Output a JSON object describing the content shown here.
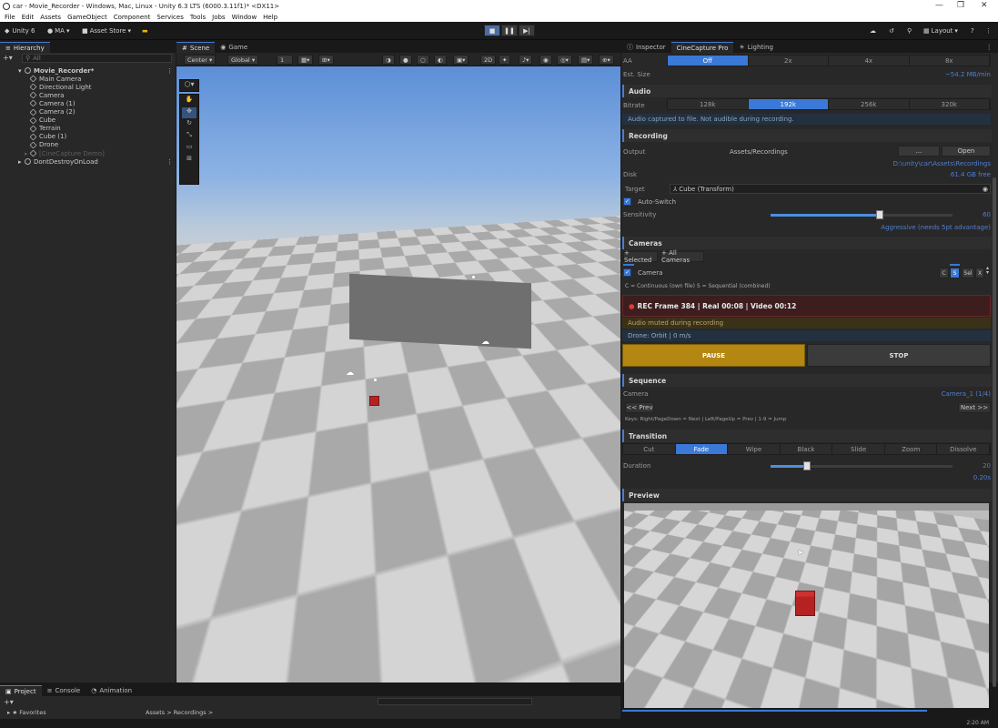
{
  "window": {
    "title": "car - Movie_Recorder - Windows, Mac, Linux - Unity 6.3 LTS (6000.3.11f1)* <DX11>",
    "controls": [
      "—",
      "❐",
      "✕"
    ]
  },
  "menu": [
    "File",
    "Edit",
    "Assets",
    "GameObject",
    "Component",
    "Services",
    "Tools",
    "Jobs",
    "Window",
    "Help"
  ],
  "toolbar": {
    "unity_label": "Unity 6",
    "account_label": "MA",
    "asset_store_label": "Asset Store",
    "layout_label": "Layout",
    "time": "2:20 AM"
  },
  "hierarchy": {
    "tab_label": "Hierarchy",
    "search_placeholder": "All",
    "items": [
      {
        "label": "Movie_Recorder*",
        "depth": 0,
        "type": "scene"
      },
      {
        "label": "Main Camera",
        "depth": 1,
        "type": "object"
      },
      {
        "label": "Directional Light",
        "depth": 1,
        "type": "object"
      },
      {
        "label": "Camera",
        "depth": 1,
        "type": "object"
      },
      {
        "label": "Camera (1)",
        "depth": 1,
        "type": "object"
      },
      {
        "label": "Camera (2)",
        "depth": 1,
        "type": "object"
      },
      {
        "label": "Cube",
        "depth": 1,
        "type": "object"
      },
      {
        "label": "Terrain",
        "depth": 1,
        "type": "object"
      },
      {
        "label": "Cube (1)",
        "depth": 1,
        "type": "object"
      },
      {
        "label": "Drone",
        "depth": 1,
        "type": "object"
      },
      {
        "label": "[CineCapture Demo]",
        "depth": 1,
        "type": "disabled"
      },
      {
        "label": "DontDestroyOnLoad",
        "depth": 0,
        "type": "scene"
      }
    ]
  },
  "scene": {
    "tabs": [
      "Scene",
      "Game"
    ],
    "pivot_label": "Center",
    "space_label": "Global",
    "grid_value": "1"
  },
  "inspector": {
    "tabs": [
      "Inspector",
      "CineCapture Pro",
      "Lighting"
    ],
    "aa": {
      "label": "AA",
      "options": [
        "Off",
        "2x",
        "4x",
        "8x"
      ],
      "selected": 0
    },
    "est_size": {
      "label": "Est. Size",
      "value": "~54.2 MB/min"
    },
    "audio": {
      "title": "Audio",
      "bitrate_label": "Bitrate",
      "bitrate_options": [
        "128k",
        "192k",
        "256k",
        "320k"
      ],
      "bitrate_selected": 1,
      "note": "Audio captured to file. Not audible during recording."
    },
    "recording": {
      "title": "Recording",
      "output_label": "Output",
      "output_value": "Assets/Recordings",
      "browse_label": "...",
      "open_label": "Open",
      "path": "D:\\unity\\car\\Assets\\Recordings",
      "disk_label": "Disk",
      "disk_value": "61.4 GB free",
      "target_label": "Target",
      "target_value": "Cube (Transform)",
      "auto_switch_label": "Auto-Switch",
      "sensitivity_label": "Sensitivity",
      "sensitivity_value": "60",
      "sensitivity_fraction": 0.6,
      "sensitivity_hint": "Aggressive (needs 5pt advantage)"
    },
    "cameras": {
      "title": "Cameras",
      "add_selected": "+ Selected",
      "add_all": "+ All Cameras",
      "camera_name": "Camera",
      "mode_c": "C",
      "mode_s": "S",
      "sel_label": "Sel",
      "remove_label": "X",
      "mode_hint": "C = Continuous (own file)  S = Sequential (combined)"
    },
    "status": {
      "rec_text": "REC  Frame 384   |   Real 00:08   |   Video 00:12",
      "audio_muted": "Audio muted during recording",
      "drone": "Drone: Orbit  |  0 m/s",
      "pause_label": "PAUSE",
      "stop_label": "STOP"
    },
    "sequence": {
      "title": "Sequence",
      "camera_label": "Camera",
      "camera_value": "Camera_1  (1/4)",
      "prev_label": "<< Prev",
      "next_label": "Next >>",
      "keys_hint": "Keys: Right/PageDown = Next  |  Left/PageUp = Prev  |  1-9 = Jump"
    },
    "transition": {
      "title": "Transition",
      "options": [
        "Cut",
        "Fade",
        "Wipe",
        "Black",
        "Slide",
        "Zoom",
        "Dissolve"
      ],
      "selected": 1,
      "duration_label": "Duration",
      "duration_value": "20",
      "duration_fraction": 0.2,
      "duration_seconds": "0.20s"
    },
    "preview": {
      "title": "Preview"
    }
  },
  "bottom": {
    "tabs": [
      "Project",
      "Console",
      "Animation"
    ],
    "favorites_label": "Favorites",
    "breadcrumb": "Assets > Recordings >"
  },
  "colors": {
    "accent": "#3a79d7",
    "rec_red": "#3d1d1d",
    "pause_gold": "#b38712",
    "cube_red": "#b52222"
  }
}
